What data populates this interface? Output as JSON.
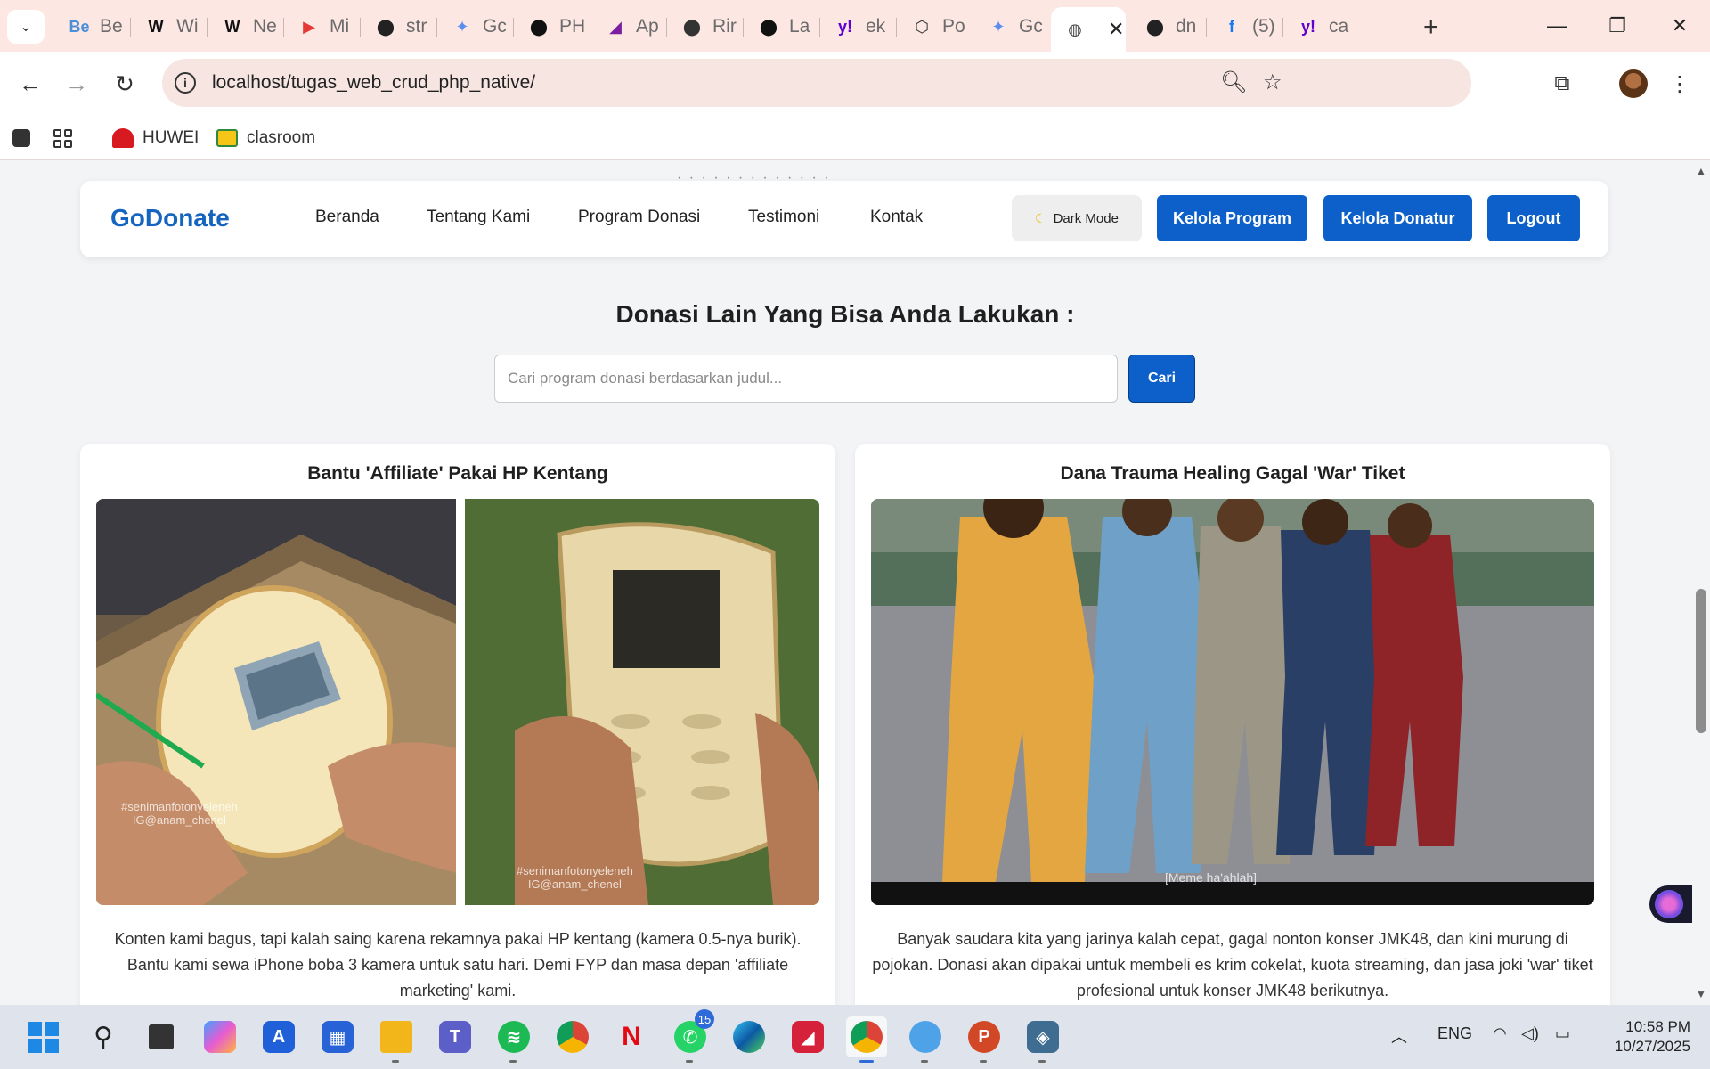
{
  "browser": {
    "tabs": [
      {
        "icon": "Be",
        "title": "Be",
        "color": "#4a8fd8"
      },
      {
        "icon": "W",
        "title": "Wi",
        "color": "#111111"
      },
      {
        "icon": "W",
        "title": "Ne",
        "color": "#111111"
      },
      {
        "icon": "▶",
        "title": "Mi",
        "color": "#e53935"
      },
      {
        "icon": "⬤",
        "title": "str",
        "color": "#222222"
      },
      {
        "icon": "✦",
        "title": "Gc",
        "color": "#5b8def"
      },
      {
        "icon": "⬤",
        "title": "PH",
        "color": "#111111"
      },
      {
        "icon": "◢",
        "title": "Ap",
        "color": "#7b1fa2"
      },
      {
        "icon": "⬤",
        "title": "Rir",
        "color": "#333333"
      },
      {
        "icon": "⬤",
        "title": "La",
        "color": "#111111"
      },
      {
        "icon": "y!",
        "title": "ek",
        "color": "#6001d2"
      },
      {
        "icon": "⬡",
        "title": "Po",
        "color": "#333333"
      },
      {
        "icon": "✦",
        "title": "Gc",
        "color": "#5b8def"
      },
      {
        "icon": "◍",
        "title": "",
        "color": "#444444",
        "active": true
      },
      {
        "icon": "⬤",
        "title": "dn",
        "color": "#222222"
      },
      {
        "icon": "f",
        "title": "(5)",
        "color": "#1877f2"
      },
      {
        "icon": "y!",
        "title": "ca",
        "color": "#6001d2"
      }
    ],
    "url": "localhost/tugas_web_crud_php_native/",
    "bookmarks": [
      {
        "label": "HUWEI"
      },
      {
        "label": "clasroom"
      }
    ]
  },
  "site": {
    "brand": "GoDonate",
    "nav": [
      "Beranda",
      "Tentang Kami",
      "Program Donasi",
      "Testimoni",
      "Kontak"
    ],
    "dark_mode_label": "Dark Mode",
    "buttons": [
      "Kelola Program",
      "Kelola Donatur",
      "Logout"
    ],
    "section_title": "Donasi Lain Yang Bisa Anda Lakukan :",
    "search": {
      "placeholder": "Cari program donasi berdasarkan judul...",
      "button": "Cari"
    },
    "cards": [
      {
        "title": "Bantu 'Affiliate' Pakai HP Kentang",
        "description": "Konten kami bagus, tapi kalah saing karena rekamnya pakai HP kentang (kamera 0.5-nya burik). Bantu kami sewa iPhone boba 3 kamera untuk satu hari. Demi FYP dan masa depan 'affiliate marketing' kami.",
        "image_watermark_1": "#senimanfotonyeleneh\nIG@anam_chenel",
        "image_watermark_2": "#senimanfotonyeleneh\nIG@anam_chenel"
      },
      {
        "title": "Dana Trauma Healing Gagal 'War' Tiket",
        "description": "Banyak saudara kita yang jarinya kalah cepat, gagal nonton konser JMK48, dan kini murung di pojokan. Donasi akan dipakai untuk membeli es krim cokelat, kuota streaming, dan jasa joki 'war' tiket profesional untuk konser JMK48 berikutnya.",
        "image_watermark": "[Meme ha'ahlah]"
      }
    ]
  },
  "taskbar": {
    "whatsapp_badge": "15",
    "language": "ENG",
    "time": "10:58 PM",
    "date": "10/27/2025"
  }
}
